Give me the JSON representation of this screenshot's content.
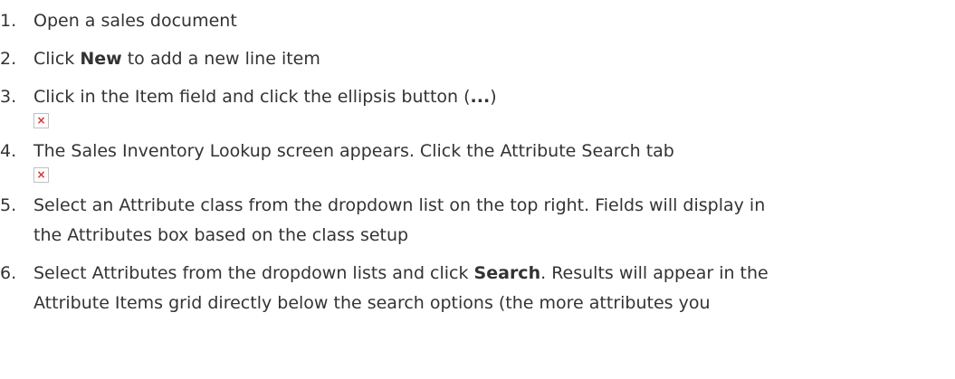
{
  "steps": [
    {
      "num": "1.",
      "text": "Open a sales document"
    },
    {
      "num": "2.",
      "before": "Click ",
      "bold": "New",
      "after": " to add a new line item"
    },
    {
      "num": "3.",
      "before": "Click in the Item field and click the ellipsis button (",
      "bold": "...",
      "after": ")",
      "image": "broken-image-icon"
    },
    {
      "num": "4.",
      "text": "The Sales Inventory Lookup screen appears. Click the Attribute Search tab",
      "image": "broken-image-icon"
    },
    {
      "num": "5.",
      "line1": "Select an Attribute class from the dropdown list on the top right. Fields will display in",
      "line2": "the Attributes box based on the class setup"
    },
    {
      "num": "6.",
      "before": "Select Attributes from the dropdown lists and click ",
      "bold": "Search",
      "after": ". Results will appear in the",
      "line2": "Attribute Items grid directly below the search options (the more attributes you"
    }
  ],
  "broken_icon_glyph": "×"
}
